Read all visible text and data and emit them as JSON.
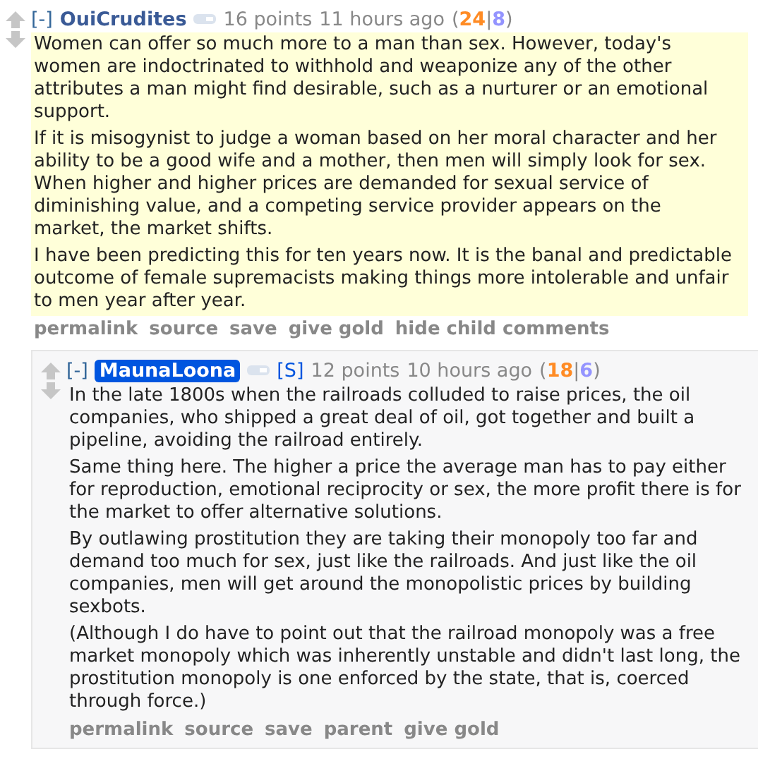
{
  "comment": {
    "collapse": "[-]",
    "author": "OuiCrudites",
    "is_submitter": false,
    "points": "16 points",
    "time": "11 hours ago",
    "score_open": "(",
    "ups": "24",
    "score_sep": "|",
    "downs": "8",
    "score_close": ")",
    "highlighted": true,
    "paragraphs": [
      "Women can offer so much more to a man than sex. However, today's women are indoctrinated to withhold and weaponize any of the other attributes a man might find desirable, such as a nurturer or an emotional support.",
      "If it is misogynist to judge a woman based on her moral character and her ability to be a good wife and a mother, then men will simply look for sex. When higher and higher prices are demanded for sexual service of diminishing value, and a competing service provider appears on the market, the market shifts.",
      "I have been predicting this for ten years now. It is the banal and predictable outcome of female supremacists making things more intolerable and unfair to men year after year."
    ],
    "actions": [
      "permalink",
      "source",
      "save",
      "give gold",
      "hide child comments"
    ],
    "children": [
      {
        "collapse": "[-]",
        "author": "MaunaLoona",
        "is_submitter": true,
        "submitter_tag": "[S]",
        "points": "12 points",
        "time": "10 hours ago",
        "score_open": "(",
        "ups": "18",
        "score_sep": "|",
        "downs": "6",
        "score_close": ")",
        "highlighted": false,
        "paragraphs": [
          "In the late 1800s when the railroads colluded to raise prices, the oil companies, who shipped a great deal of oil, got together and built a pipeline, avoiding the railroad entirely.",
          "Same thing here. The higher a price the average man has to pay either for reproduction, emotional reciprocity or sex, the more profit there is for the market to offer alternative solutions.",
          "By outlawing prostitution they are taking their monopoly too far and demand too much for sex, just like the railroads. And just like the oil companies, men will get around the monopolistic prices by building sexbots.",
          "(Although I do have to point out that the railroad monopoly was a free market monopoly which was inherently unstable and didn't last long, the prostitution monopoly is one enforced by the state, that is, coerced through force.)"
        ],
        "actions": [
          "permalink",
          "source",
          "save",
          "parent",
          "give gold"
        ]
      }
    ]
  }
}
